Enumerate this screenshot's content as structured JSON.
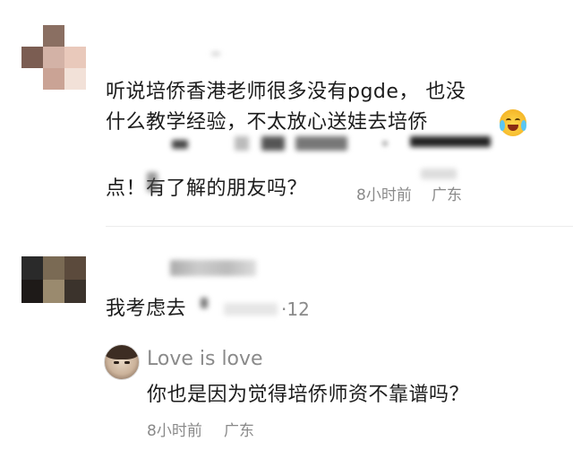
{
  "comment1": {
    "line1": "听说培侨香港老师很多没有pgde，  也没",
    "line2": "什么教学经验，不太放心送娃去培侨",
    "line4": "点！有了解的朋友吗？",
    "time": "8小时前",
    "location": "广东",
    "emoji": "crying-laughing-emoji"
  },
  "comment2": {
    "text": "我考虑去",
    "suffix": "·12"
  },
  "reply": {
    "username": "Love is love",
    "text": "你也是因为觉得培侨师资不靠谱吗？",
    "time": "8小时前",
    "location": "广东"
  },
  "colors": {
    "text": "#1c1c1c",
    "meta": "#8a8a8a"
  }
}
